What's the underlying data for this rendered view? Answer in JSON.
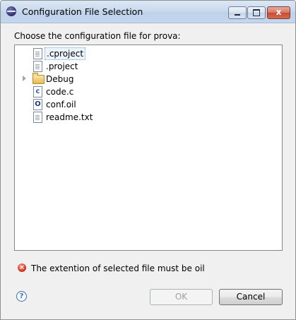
{
  "window": {
    "title": "Configuration File Selection",
    "close_glyph": "x",
    "icon": "eclipse-app-icon"
  },
  "prompt": "Choose the configuration file for prova:",
  "tree": {
    "items": [
      {
        "label": ".cproject",
        "icon": "text-file-icon",
        "selected": true
      },
      {
        "label": ".project",
        "icon": "text-file-icon",
        "selected": false
      },
      {
        "label": "Debug",
        "icon": "folder-icon",
        "expandable": true,
        "selected": false
      },
      {
        "label": "code.c",
        "icon": "c-file-icon",
        "icon_letter": "c",
        "selected": false
      },
      {
        "label": "conf.oil",
        "icon": "oil-file-icon",
        "icon_letter": "O",
        "selected": false
      },
      {
        "label": "readme.txt",
        "icon": "text-file-icon",
        "selected": false
      }
    ]
  },
  "error": {
    "icon_glyph": "×",
    "message": "The extention of selected file must be oil"
  },
  "help": {
    "glyph": "?"
  },
  "buttons": {
    "ok_label": "OK",
    "ok_enabled": false,
    "cancel_label": "Cancel"
  },
  "colors": {
    "selection_bg": "#ebf3fd",
    "error_red": "#d63a22",
    "help_blue": "#3a6fb5"
  }
}
